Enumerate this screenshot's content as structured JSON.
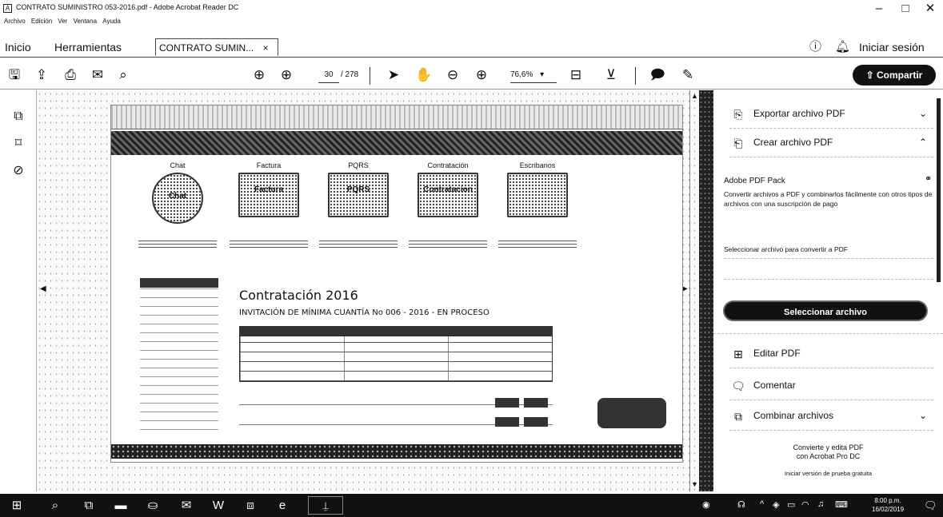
{
  "window": {
    "title": "CONTRATO SUMINISTRO 053-2016.pdf - Adobe Acrobat Reader DC",
    "minimize": "–",
    "maximize": "□",
    "close": "✕"
  },
  "menu": [
    "Archivo",
    "Edición",
    "Ver",
    "Ventana",
    "Ayuda"
  ],
  "tabs": {
    "home": "Inicio",
    "tools": "Herramientas",
    "document": "CONTRATO SUMIN...",
    "close": "×",
    "sign_in": "Iniciar sesión"
  },
  "toolbar": {
    "page_current": "30",
    "page_total": "/ 278",
    "zoom": "76,6%",
    "share": "Compartir"
  },
  "document": {
    "cards": [
      {
        "header": "Chat",
        "label": "Chat"
      },
      {
        "header": "Factura",
        "label": "Factura"
      },
      {
        "header": "PQRS",
        "label": "PQRS"
      },
      {
        "header": "Contratación",
        "label": "Contratacion"
      },
      {
        "header": "Escribanos",
        "label": ""
      }
    ],
    "heading": "Contratación 2016",
    "subheading": "INVITACIÓN DE MÍNIMA CUANTÍA No 006 - 2016 - EN PROCESO"
  },
  "right_pane": {
    "export_pdf": "Exportar archivo PDF",
    "create_pdf": "Crear archivo PDF",
    "pack_title": "Adobe PDF Pack",
    "pack_desc": "Convertir archivos a PDF y combinarlos fácilmente con otros tipos de archivos con una suscripción de pago",
    "select_label": "Seleccionar archivo para convertir a PDF",
    "select_button": "Seleccionar archivo",
    "edit_pdf": "Editar PDF",
    "comment": "Comentar",
    "combine": "Combinar archivos",
    "promo_line1": "Convierte y edita PDF",
    "promo_line2": "con Acrobat Pro DC",
    "promo_trial": "Iniciar versión de prueba gratuita"
  },
  "taskbar": {
    "time": "8:00 p.m.",
    "date": "16/02/2019"
  }
}
